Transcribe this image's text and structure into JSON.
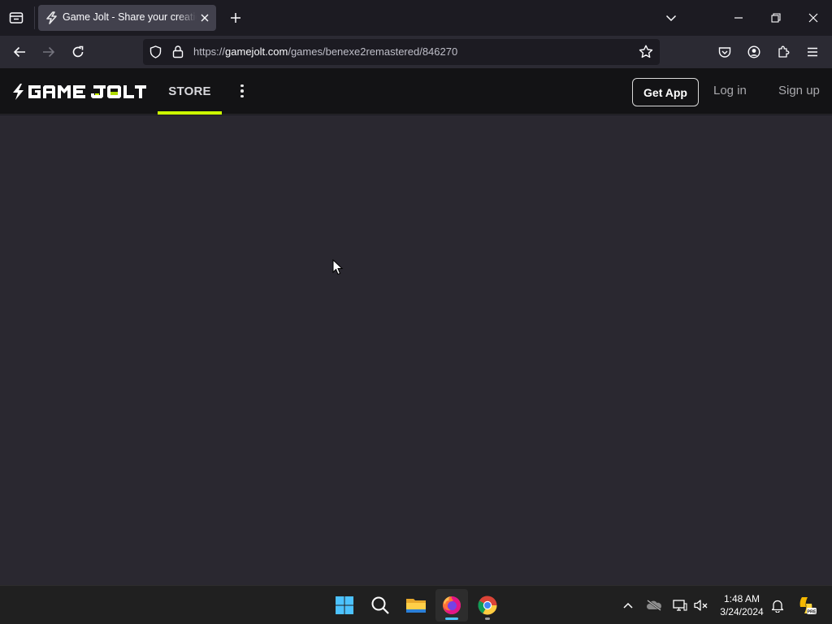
{
  "browser": {
    "tab": {
      "title": "Game Jolt - Share your creations",
      "favicon": "gamejolt-bolt-icon"
    },
    "url": {
      "scheme": "https://",
      "host": "gamejolt.com",
      "path": "/games/benexe2remastered/846270"
    },
    "icons": [
      "tab-overview-icon",
      "new-tab-icon",
      "tab-list-icon",
      "minimize-icon",
      "restore-icon",
      "close-icon",
      "back-icon",
      "forward-icon",
      "reload-icon",
      "shield-icon",
      "lock-icon",
      "bookmark-star-icon",
      "pocket-icon",
      "account-icon",
      "extensions-icon",
      "menu-icon"
    ]
  },
  "site": {
    "logo_text": "GAME JOLT",
    "nav": {
      "store": "STORE"
    },
    "actions": {
      "get_app": "Get App",
      "log_in": "Log in",
      "sign_up": "Sign up"
    },
    "colors": {
      "accent": "#ccff00",
      "header_bg": "#131315",
      "content_bg": "#2a2830"
    }
  },
  "taskbar": {
    "apps": [
      "start-icon",
      "search-icon",
      "file-explorer-icon",
      "firefox-icon",
      "chrome-icon"
    ],
    "tray": [
      "chevron-up-icon",
      "onedrive-off-icon",
      "network-icon",
      "volume-muted-icon",
      "notification-bell-icon",
      "copilot-pre-icon"
    ],
    "clock": {
      "time": "1:48 AM",
      "date": "3/24/2024"
    }
  }
}
